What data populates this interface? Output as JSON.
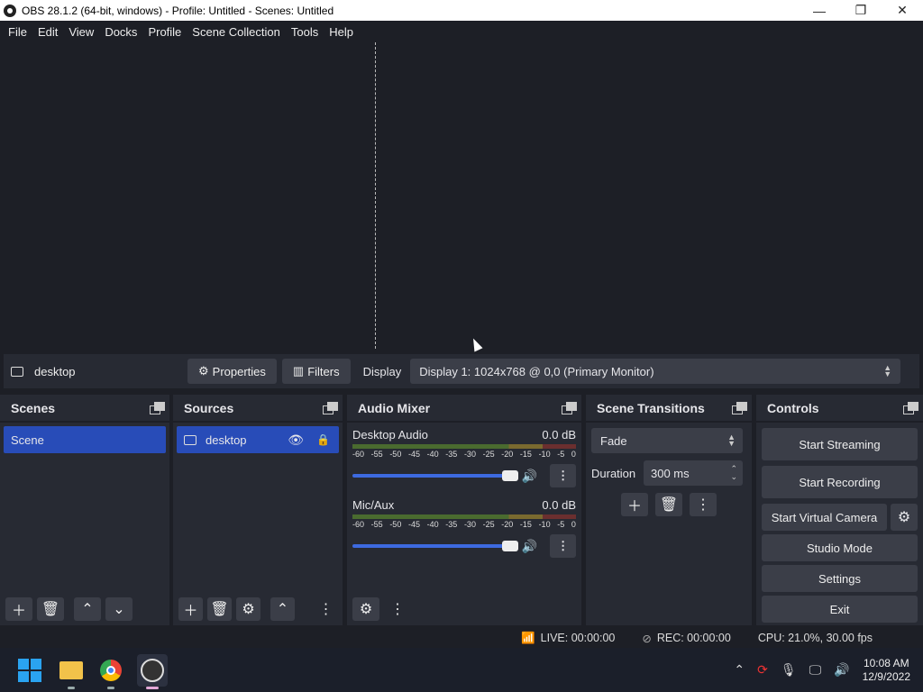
{
  "window": {
    "title": "OBS 28.1.2 (64-bit, windows) - Profile: Untitled - Scenes: Untitled",
    "minimize": "—",
    "maximize": "❐",
    "close": "✕"
  },
  "menu": [
    "File",
    "Edit",
    "View",
    "Docks",
    "Profile",
    "Scene Collection",
    "Tools",
    "Help"
  ],
  "source_toolbar": {
    "source_name": "desktop",
    "properties_label": "Properties",
    "filters_label": "Filters",
    "display_label": "Display",
    "display_value": "Display 1: 1024x768 @ 0,0 (Primary Monitor)"
  },
  "scenes": {
    "title": "Scenes",
    "items": [
      "Scene"
    ]
  },
  "sources": {
    "title": "Sources",
    "items": [
      "desktop"
    ]
  },
  "audio_mixer": {
    "title": "Audio Mixer",
    "channels": [
      {
        "name": "Desktop Audio",
        "level": "0.0 dB"
      },
      {
        "name": "Mic/Aux",
        "level": "0.0 dB"
      }
    ],
    "scale": [
      "-60",
      "-55",
      "-50",
      "-45",
      "-40",
      "-35",
      "-30",
      "-25",
      "-20",
      "-15",
      "-10",
      "-5",
      "0"
    ]
  },
  "transitions": {
    "title": "Scene Transitions",
    "selected": "Fade",
    "duration_label": "Duration",
    "duration_value": "300 ms"
  },
  "controls": {
    "title": "Controls",
    "start_streaming": "Start Streaming",
    "start_recording": "Start Recording",
    "start_virtual_camera": "Start Virtual Camera",
    "studio_mode": "Studio Mode",
    "settings": "Settings",
    "exit": "Exit"
  },
  "status": {
    "live": "LIVE: 00:00:00",
    "rec": "REC: 00:00:00",
    "cpu": "CPU: 21.0%, 30.00 fps"
  },
  "taskbar": {
    "time": "10:08 AM",
    "date": "12/9/2022"
  }
}
